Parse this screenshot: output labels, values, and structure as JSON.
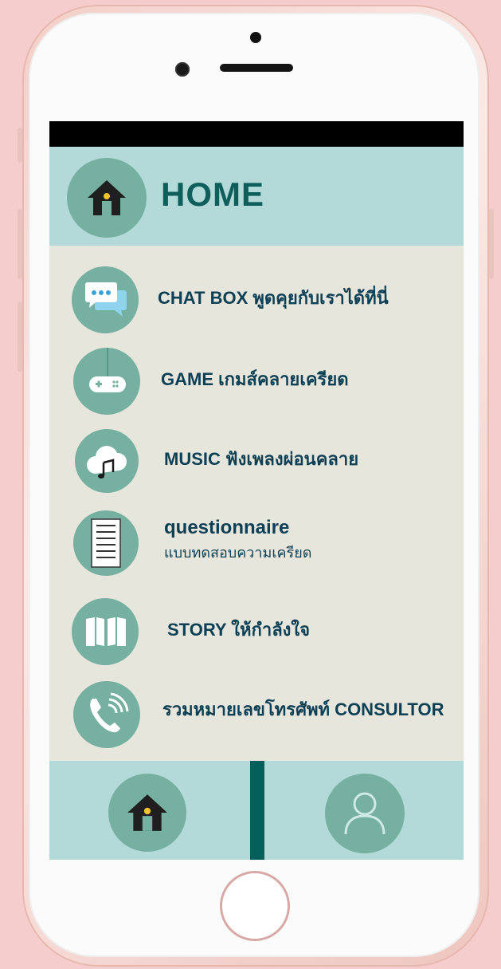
{
  "header": {
    "title": "HOME"
  },
  "menu": {
    "items": [
      {
        "label": "CHAT  BOX  พูดคุยกับเราได้ที่นี่",
        "icon": "chat-bubbles-icon"
      },
      {
        "label": "GAME  เกมส์คลายเครียด",
        "icon": "gamepad-icon"
      },
      {
        "label": "MUSIC  ฟังเพลงผ่อนคลาย",
        "icon": "music-cloud-icon"
      },
      {
        "label": "questionnaire",
        "sublabel": "แบบทดสอบความเครียด",
        "icon": "document-icon"
      },
      {
        "label": "STORY  ให้กำลังใจ",
        "icon": "open-book-icon"
      },
      {
        "label": "รวมหมายเลขโทรศัพท์  CONSULTOR",
        "icon": "phone-call-icon"
      }
    ]
  },
  "bottom_nav": {
    "home": {
      "icon": "home-icon"
    },
    "profile": {
      "icon": "user-icon"
    }
  },
  "colors": {
    "page_bg": "#f6cdcd",
    "header_bg": "#b3dad9",
    "circle": "#76b0a0",
    "content_bg": "#e6e6dc",
    "title": "#0e5f5c",
    "label": "#0d3f55",
    "divider": "#04605b"
  }
}
